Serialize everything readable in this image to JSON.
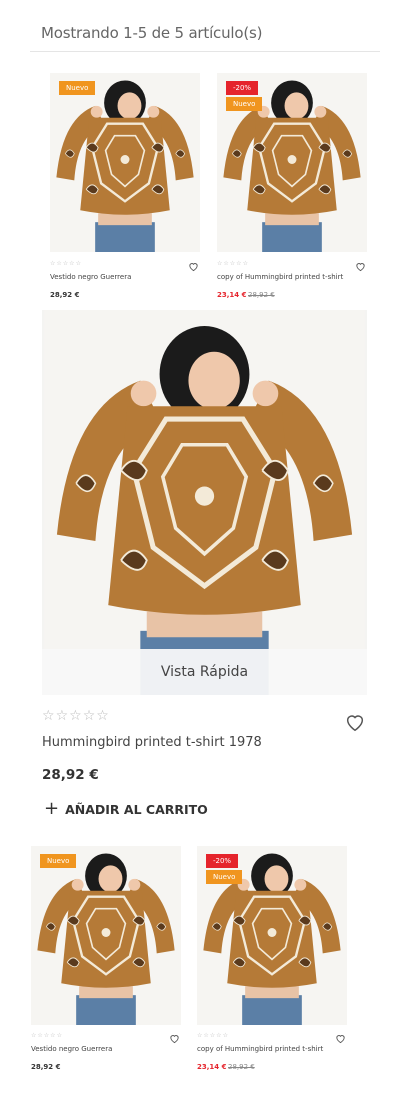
{
  "results": {
    "text": "Mostrando 1-5 de 5 artículo(s)"
  },
  "icons": {
    "rating": "star-outline-icon",
    "wishlist": "heart-outline-icon",
    "add": "plus-icon"
  },
  "colors": {
    "badge_new": "#f0951f",
    "badge_sale": "#e5242c",
    "sale_price": "#e5242c"
  },
  "products": [
    {
      "name": "Vestido negro Guerrera",
      "price": "28,92 €",
      "badges": [
        "Nuevo"
      ],
      "rating": 0
    },
    {
      "name": "copy of Hummingbird printed t-shirt",
      "price": "23,14 €",
      "old_price": "28,92 €",
      "badges": [
        "-20%",
        "Nuevo"
      ],
      "rating": 0
    },
    {
      "name": "Hummingbird printed t-shirt 1978",
      "price": "28,92 €",
      "quick_view": "Vista Rápida",
      "add_to_cart": "AÑADIR AL CARRITO",
      "rating": 0
    },
    {
      "name": "Vestido negro Guerrera",
      "price": "28,92 €",
      "badges": [
        "Nuevo"
      ],
      "rating": 0
    },
    {
      "name": "copy of Hummingbird printed t-shirt",
      "price": "23,14 €",
      "old_price": "28,92 €",
      "badges": [
        "-20%",
        "Nuevo"
      ],
      "rating": 0
    }
  ]
}
